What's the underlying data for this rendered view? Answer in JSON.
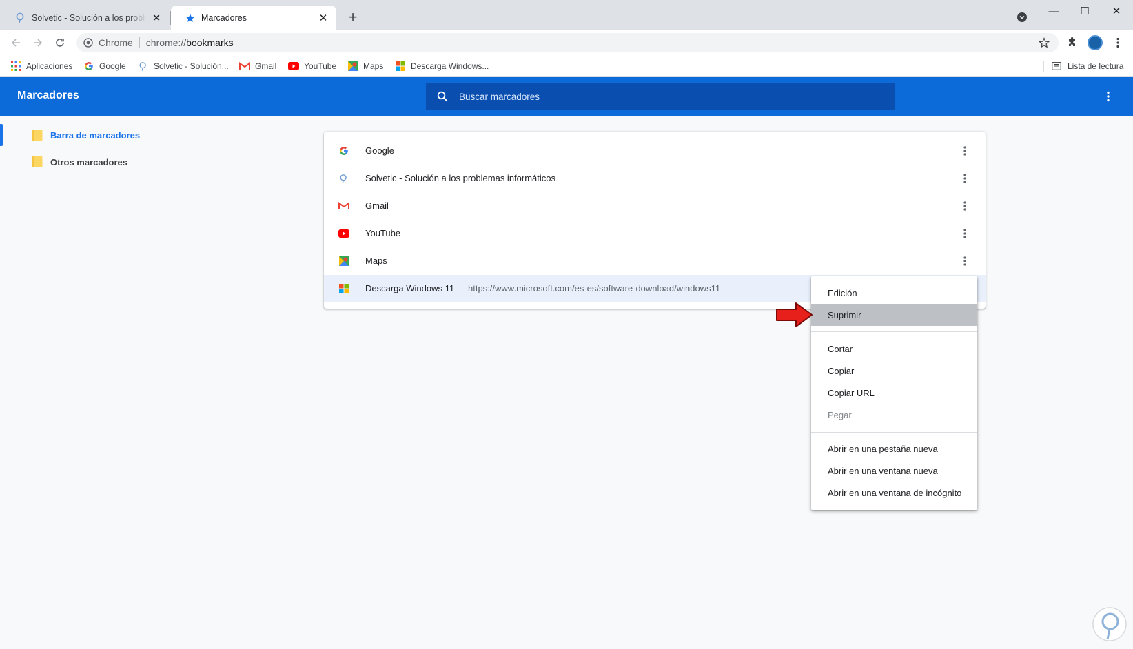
{
  "tabs": [
    {
      "title": "Solvetic - Solución a los problemas informáticos",
      "icon": "solvetic-icon",
      "active": false
    },
    {
      "title": "Marcadores",
      "icon": "star-icon",
      "active": true
    }
  ],
  "window_controls": {
    "new_tab": "+",
    "minimize": "—",
    "maximize": "☐",
    "close": "✕"
  },
  "toolbar": {
    "site_label": "Chrome",
    "url_scheme": "chrome://",
    "url_host": "bookmarks"
  },
  "bookmarks_bar": {
    "items": [
      {
        "label": "Aplicaciones",
        "icon": "apps-grid-icon"
      },
      {
        "label": "Google",
        "icon": "google-icon"
      },
      {
        "label": "Solvetic - Solución...",
        "icon": "solvetic-icon"
      },
      {
        "label": "Gmail",
        "icon": "gmail-icon"
      },
      {
        "label": "YouTube",
        "icon": "youtube-icon"
      },
      {
        "label": "Maps",
        "icon": "maps-icon"
      },
      {
        "label": "Descarga Windows...",
        "icon": "windows-icon"
      }
    ],
    "reading_list": "Lista de lectura"
  },
  "header": {
    "title": "Marcadores",
    "search_placeholder": "Buscar marcadores"
  },
  "sidebar": {
    "folders": [
      {
        "label": "Barra de marcadores",
        "selected": true
      },
      {
        "label": "Otros marcadores",
        "selected": false
      }
    ]
  },
  "bookmarks": [
    {
      "title": "Google",
      "url": "",
      "icon": "google-icon"
    },
    {
      "title": "Solvetic - Solución a los problemas informáticos",
      "url": "",
      "icon": "solvetic-icon"
    },
    {
      "title": "Gmail",
      "url": "",
      "icon": "gmail-icon"
    },
    {
      "title": "YouTube",
      "url": "",
      "icon": "youtube-icon"
    },
    {
      "title": "Maps",
      "url": "",
      "icon": "maps-icon"
    },
    {
      "title": "Descarga Windows 11",
      "url": "https://www.microsoft.com/es-es/software-download/windows11",
      "icon": "windows-icon",
      "highlighted": true
    }
  ],
  "context_menu": {
    "items": [
      {
        "label": "Edición",
        "state": "normal"
      },
      {
        "label": "Suprimir",
        "state": "hover"
      },
      {
        "label": "Cortar",
        "state": "normal"
      },
      {
        "label": "Copiar",
        "state": "normal"
      },
      {
        "label": "Copiar URL",
        "state": "normal"
      },
      {
        "label": "Pegar",
        "state": "disabled"
      },
      {
        "label": "Abrir en una pestaña nueva",
        "state": "normal"
      },
      {
        "label": "Abrir en una ventana nueva",
        "state": "normal"
      },
      {
        "label": "Abrir en una ventana de incógnito",
        "state": "normal"
      }
    ]
  },
  "colors": {
    "header_blue": "#0c6ad9",
    "search_blue": "#0a4fb0",
    "accent_blue": "#1a73e8",
    "annotation_red": "#e8201c",
    "folder_yellow": "#fcd663"
  }
}
